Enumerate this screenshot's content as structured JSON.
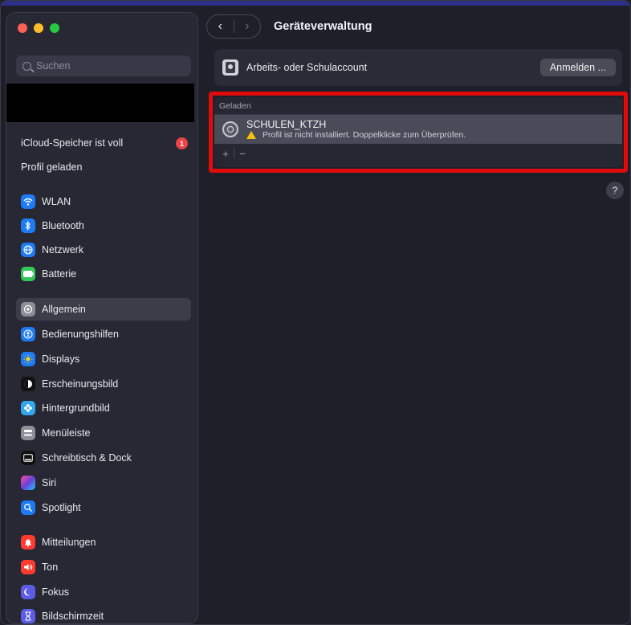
{
  "window": {
    "title": "Geräteverwaltung"
  },
  "sidebar": {
    "search_placeholder": "Suchen",
    "alerts": [
      {
        "label": "iCloud-Speicher ist voll",
        "badge": "1"
      },
      {
        "label": "Profil geladen"
      }
    ],
    "groups": [
      [
        {
          "label": "WLAN",
          "icon": "wifi-icon",
          "color": "#1e7bf6"
        },
        {
          "label": "Bluetooth",
          "icon": "bluetooth-icon",
          "color": "#1e7bf6"
        },
        {
          "label": "Netzwerk",
          "icon": "globe-icon",
          "color": "#1e7bf6"
        },
        {
          "label": "Batterie",
          "icon": "battery-icon",
          "color": "#34c759"
        }
      ],
      [
        {
          "label": "Allgemein",
          "icon": "gear-icon",
          "color": "#8e8e98",
          "selected": true
        },
        {
          "label": "Bedienungshilfen",
          "icon": "accessibility-icon",
          "color": "#1e7bf6"
        },
        {
          "label": "Displays",
          "icon": "sun-icon",
          "color": "#1e7bf6"
        },
        {
          "label": "Erscheinungsbild",
          "icon": "appearance-icon",
          "color": "#111111"
        },
        {
          "label": "Hintergrundbild",
          "icon": "wallpaper-icon",
          "color": "#33a7ee"
        },
        {
          "label": "Menüleiste",
          "icon": "menubar-icon",
          "color": "#8e8e98"
        },
        {
          "label": "Schreibtisch & Dock",
          "icon": "dock-icon",
          "color": "#111111"
        },
        {
          "label": "Siri",
          "icon": "siri-icon",
          "color": "#6b3fd6"
        },
        {
          "label": "Spotlight",
          "icon": "spotlight-icon",
          "color": "#1e7bf6"
        }
      ],
      [
        {
          "label": "Mitteilungen",
          "icon": "bell-icon",
          "color": "#ff3b30"
        },
        {
          "label": "Ton",
          "icon": "speaker-icon",
          "color": "#ff3b30"
        },
        {
          "label": "Fokus",
          "icon": "moon-icon",
          "color": "#5e5ce6"
        },
        {
          "label": "Bildschirmzeit",
          "icon": "hourglass-icon",
          "color": "#5e5ce6"
        }
      ]
    ]
  },
  "toolbar": {
    "back": "‹",
    "forward": "›"
  },
  "main": {
    "account": {
      "label": "Arbeits- oder Schulaccount",
      "button": "Anmelden ..."
    },
    "loaded": {
      "header": "Geladen",
      "profile_name": "SCHULEN_KTZH",
      "profile_status": "Profil ist nicht installiert. Doppelklicke zum Überprüfen.",
      "add": "+",
      "remove": "−"
    },
    "help": "?"
  },
  "colors": {
    "highlight": "#e20b0b",
    "accent": "#1e7bf6"
  }
}
